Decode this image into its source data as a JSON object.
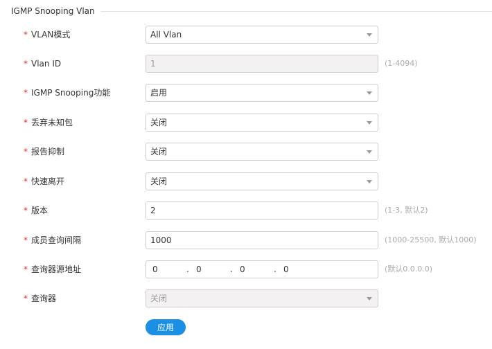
{
  "section": {
    "title": "IGMP Snooping Vlan"
  },
  "required_mark": "*",
  "form": {
    "vlan_mode": {
      "label": "VLAN模式",
      "value": "All Vlan"
    },
    "vlan_id": {
      "label": "Vlan ID",
      "value": "1",
      "hint": "(1-4094)"
    },
    "igmp_snooping": {
      "label": "IGMP Snooping功能",
      "value": "启用"
    },
    "drop_unknown": {
      "label": "丢弃未知包",
      "value": "关闭"
    },
    "report_suppress": {
      "label": "报告抑制",
      "value": "关闭"
    },
    "fast_leave": {
      "label": "快速离开",
      "value": "关闭"
    },
    "version": {
      "label": "版本",
      "value": "2",
      "hint": "(1-3, 默认2)"
    },
    "member_query_interval": {
      "label": "成员查询间隔",
      "value": "1000",
      "hint": "(1000-25500, 默认1000)"
    },
    "querier_source_address": {
      "label": "查询器源地址",
      "octets": [
        "0",
        "0",
        "0",
        "0"
      ],
      "hint": "(默认0.0.0.0)"
    },
    "querier": {
      "label": "查询器",
      "value": "关闭"
    }
  },
  "apply_button": {
    "label": "应用",
    "color": "#1a8fe3"
  },
  "colors": {
    "required": "#e0322b",
    "disabled_bg": "#f4f1f3",
    "hint": "#aaaaaa"
  },
  "icons": {
    "dropdown": "chevron-down-icon"
  }
}
